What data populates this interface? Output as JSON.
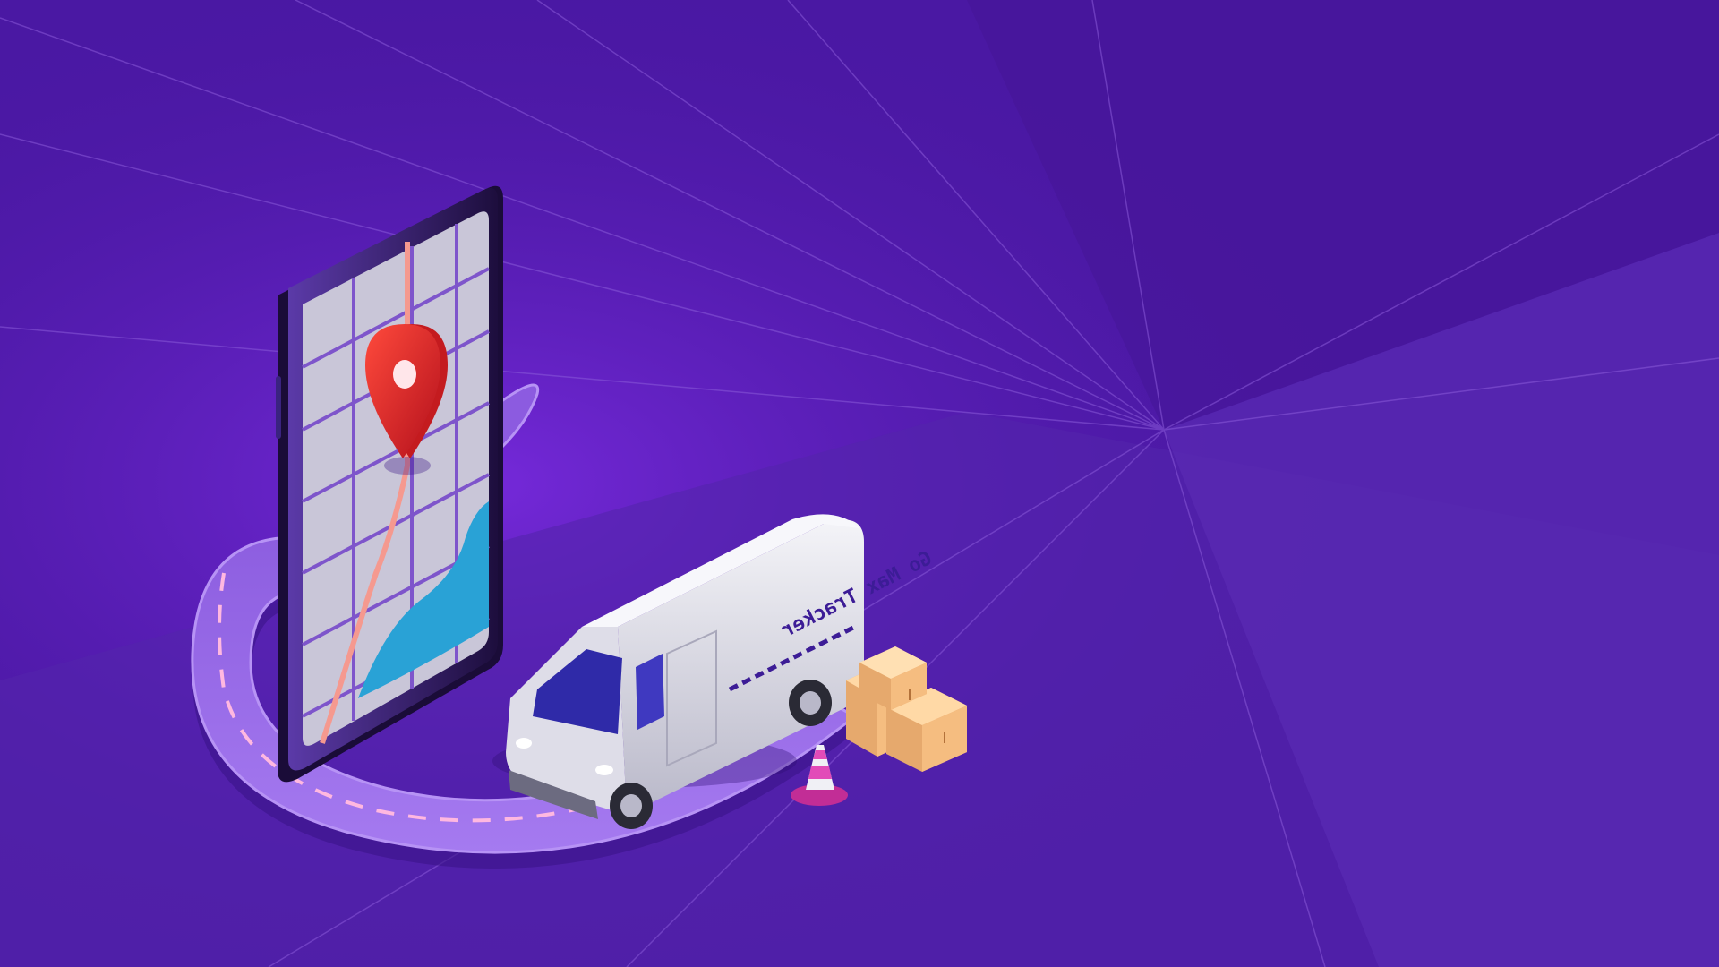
{
  "banner": {
    "van_brand": "Go Max Tracker"
  },
  "colors": {
    "background": "#4a18a3",
    "background_light": "#6a36bf",
    "road": "#9566e6",
    "road_dash": "#ffb8e0",
    "phone_body": "#27134f",
    "map_screen": "#c9c6d8",
    "map_streets": "#7e55cb",
    "map_route": "#f5998f",
    "map_river": "#29a2d6",
    "location_pin": "#e51f24",
    "van_body": "#e6e6ee",
    "van_window": "#2f2aa8",
    "boxes": "#f9c98a",
    "traffic_cone": "#e24bb8"
  },
  "icons": [
    "location-pin-icon",
    "traffic-cone-icon",
    "cardboard-box-icon",
    "delivery-van-icon",
    "smartphone-icon"
  ]
}
